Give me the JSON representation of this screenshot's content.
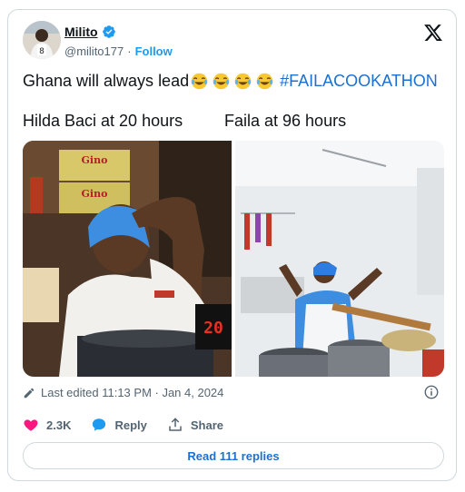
{
  "author": {
    "name": "Milito",
    "handle": "@milito177",
    "separator": "·",
    "follow_label": "Follow"
  },
  "tweet": {
    "text": "Ghana will always lead",
    "hashtag": "#FAILACOOKATHON",
    "caption_left": "Hilda Baci at 20 hours",
    "caption_right": "Faila at 96 hours"
  },
  "media": {
    "left_sign_1": "Gino",
    "left_sign_2": "Gino",
    "left_clock": "20"
  },
  "meta": {
    "edited_text": "Last edited 11:13 PM · Jan 4, 2024"
  },
  "actions": {
    "likes": "2.3K",
    "reply_label": "Reply",
    "share_label": "Share"
  },
  "replies_button_label": "Read 111 replies",
  "colors": {
    "accent": "#1d9bf0",
    "link": "#1d6fd1",
    "like": "#f91880",
    "muted": "#536471"
  }
}
